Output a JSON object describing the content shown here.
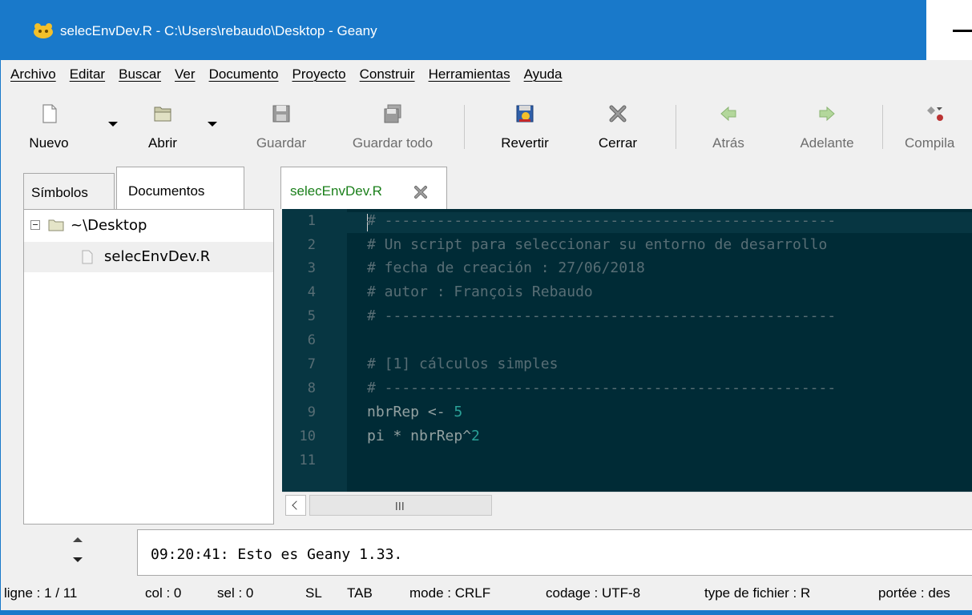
{
  "window": {
    "title": "selecEnvDev.R - C:\\Users\\rebaudo\\Desktop - Geany",
    "accent_color": "#1979ca"
  },
  "menu": {
    "items": [
      {
        "label": "Archivo"
      },
      {
        "label": "Editar"
      },
      {
        "label": "Buscar"
      },
      {
        "label": "Ver"
      },
      {
        "label": "Documento"
      },
      {
        "label": "Proyecto"
      },
      {
        "label": "Construir"
      },
      {
        "label": "Herramientas"
      },
      {
        "label": "Ayuda"
      }
    ]
  },
  "toolbar": {
    "new_label": "Nuevo",
    "open_label": "Abrir",
    "save_label": "Guardar",
    "save_all_label": "Guardar todo",
    "revert_label": "Revertir",
    "close_label": "Cerrar",
    "back_label": "Atrás",
    "forward_label": "Adelante",
    "compile_label": "Compila"
  },
  "sidebar": {
    "tabs": [
      {
        "label": "Símbolos"
      },
      {
        "label": "Documentos"
      }
    ],
    "tree": {
      "folder": "~\\Desktop",
      "file": "selecEnvDev.R"
    }
  },
  "editor": {
    "tab_label": "selecEnvDev.R",
    "line_numbers": [
      "1",
      "2",
      "3",
      "4",
      "5",
      "6",
      "7",
      "8",
      "9",
      "10",
      "11"
    ],
    "lines": {
      "l1": "# ----------------------------------------------------",
      "l2": "# Un script para seleccionar su entorno de desarrollo",
      "l3": "# fecha de creación : 27/06/2018",
      "l4": "# autor : François Rebaudo",
      "l5": "# ----------------------------------------------------",
      "l6": "",
      "l7": "# [1] cálculos simples",
      "l8": "# ----------------------------------------------------",
      "l9_code": "nbrRep <- ",
      "l9_num": "5",
      "l10_code": "pi * nbrRep^",
      "l10_num": "2",
      "l11": ""
    },
    "background_color": "#002b36",
    "comment_color": "#586e75",
    "number_color": "#2aa198"
  },
  "messages": {
    "text": "09:20:41: Esto es Geany 1.33."
  },
  "statusbar": {
    "line": "ligne : 1 / 11",
    "col": "col : 0",
    "sel": "sel : 0",
    "sl": "SL",
    "tab": "TAB",
    "mode": "mode : CRLF",
    "encoding": "codage : UTF-8",
    "filetype": "type de fichier : R",
    "scope": "portée : des"
  }
}
